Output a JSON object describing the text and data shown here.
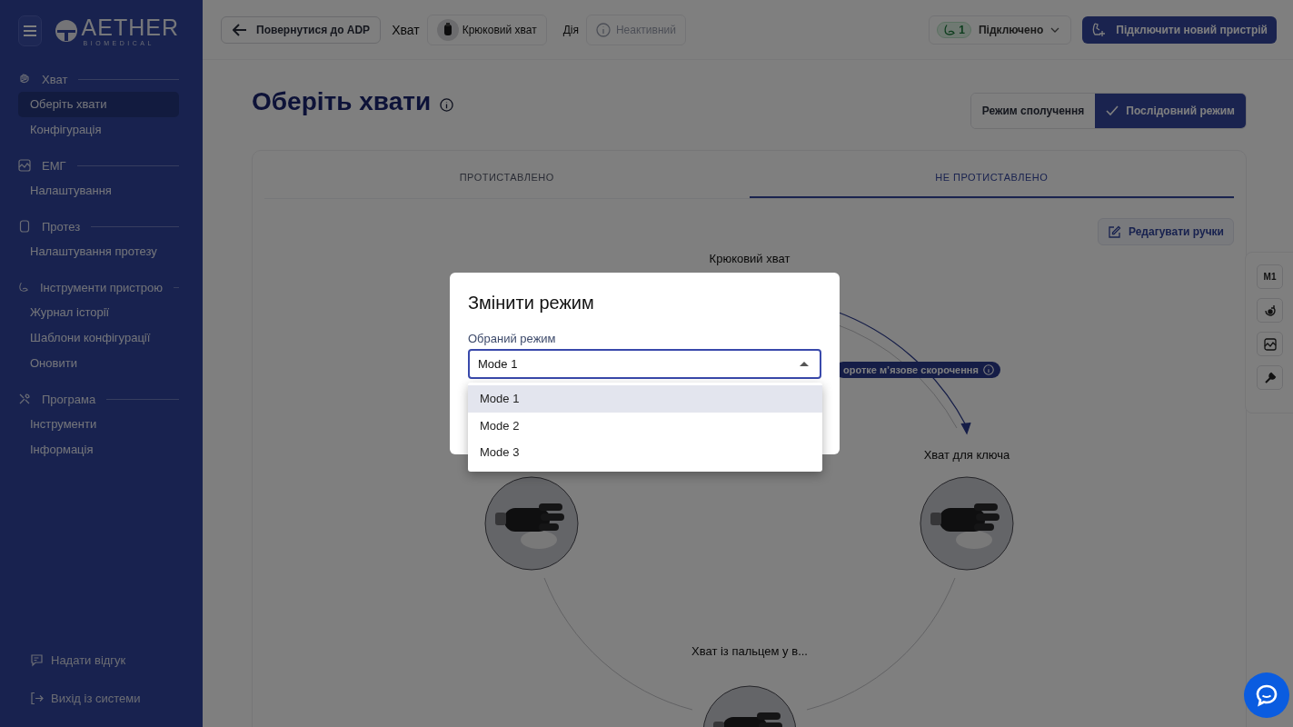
{
  "sidebar": {
    "logo": {
      "name": "AETHER",
      "tagline": "BIOMEDICAL"
    },
    "sections": [
      {
        "title": "Хват",
        "items": [
          {
            "label": "Оберіть хвати",
            "selected": true
          },
          {
            "label": "Конфігурація",
            "selected": false
          }
        ]
      },
      {
        "title": "ЕМГ",
        "items": [
          {
            "label": "Налаштування",
            "selected": false
          }
        ]
      },
      {
        "title": "Протез",
        "items": [
          {
            "label": "Налаштування протезу",
            "selected": false
          }
        ]
      },
      {
        "title": "Інструменти пристрою",
        "items": [
          {
            "label": "Журнал історії",
            "selected": false
          },
          {
            "label": "Шаблони конфігурації",
            "selected": false
          },
          {
            "label": "Оновити",
            "selected": false
          }
        ]
      },
      {
        "title": "Програма",
        "items": [
          {
            "label": "Інструменти",
            "selected": false
          },
          {
            "label": "Інформація",
            "selected": false
          }
        ]
      }
    ],
    "footer": [
      "Надати відгук",
      "Вихід із системи"
    ]
  },
  "topbar": {
    "back_button": "Повернутися до ADP",
    "grip_label": "Хват",
    "grip_value": "Крюковий хват",
    "action_label": "Дія",
    "action_value": "Неактивний",
    "device_count": "1",
    "device_status": "Підключено",
    "connect_button": "Підключити новий пристрій"
  },
  "page": {
    "title": "Оберіть хвати",
    "modes": [
      {
        "label": "Режим сполучення",
        "selected": false
      },
      {
        "label": "Послідовний режим",
        "selected": true
      }
    ]
  },
  "card": {
    "tabs": [
      {
        "label": "ПРОТИСТАВЛЕНО",
        "selected": false
      },
      {
        "label": "НЕ ПРОТИСТАВЛЕНО",
        "selected": true
      }
    ],
    "edit_button": "Редагувати ручки",
    "grips": [
      {
        "label": "Крюковий хват"
      },
      {
        "label": "Хват для ключа"
      },
      {
        "label": "Хват із пальцем у в..."
      }
    ],
    "transition": "оротке м’язове скорочення"
  },
  "side_toolbar": {
    "mode_button": "M1"
  },
  "dialog": {
    "title": "Змінити режим",
    "field_label": "Обраний режим",
    "value": "Mode 1",
    "options": [
      {
        "label": "Mode 1",
        "selected": true
      },
      {
        "label": "Mode 2",
        "selected": false
      },
      {
        "label": "Mode 3",
        "selected": false
      }
    ]
  }
}
